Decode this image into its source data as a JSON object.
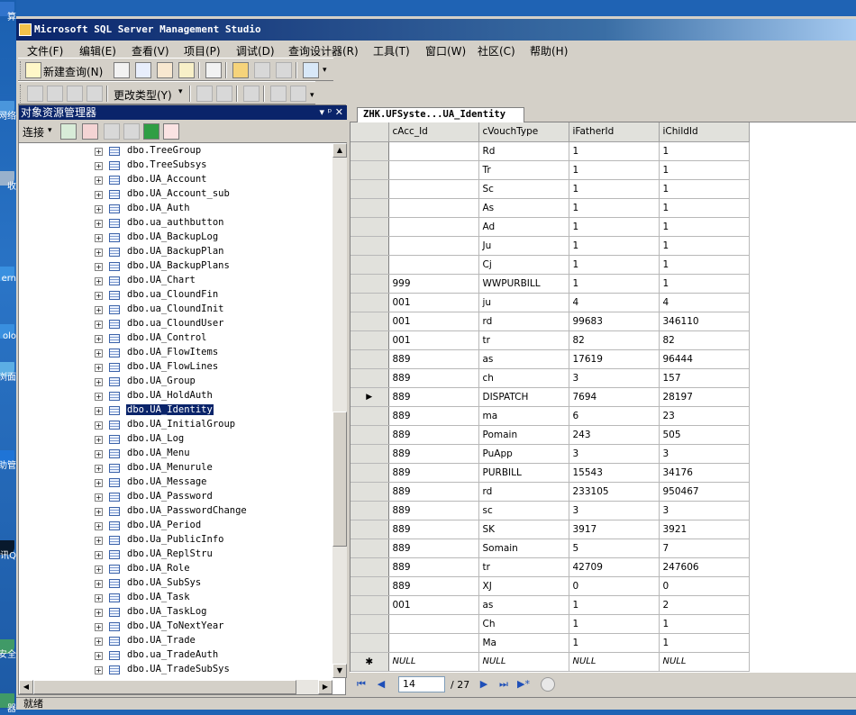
{
  "desktop": {
    "icons": [
      {
        "label": "算",
        "color": "#3a7bd5"
      },
      {
        "label": "网络",
        "color": "#58a6e8"
      },
      {
        "label": "收",
        "color": "#c0c8d0"
      },
      {
        "label": "ern",
        "color": "#3f9ae8"
      },
      {
        "label": "olo",
        "color": "#3f9ae8"
      },
      {
        "label": "浏面",
        "color": "#6fc3f0"
      },
      {
        "label": "助管",
        "color": "#1e78e0"
      },
      {
        "label": "讯Q",
        "color": "#000000"
      },
      {
        "label": "安全",
        "color": "#4caf50"
      },
      {
        "label": "器",
        "color": "#4caf50"
      }
    ]
  },
  "window": {
    "title": "Microsoft SQL Server Management Studio"
  },
  "menu": [
    "文件(F)",
    "编辑(E)",
    "查看(V)",
    "项目(P)",
    "调试(D)",
    "查询设计器(R)",
    "工具(T)",
    "窗口(W)",
    "社区(C)",
    "帮助(H)"
  ],
  "toolbar": {
    "new_query": "新建查询(N)",
    "change_type": "更改类型(Y)"
  },
  "object_explorer": {
    "title": "对象资源管理器",
    "pin_controls": "▾ ᵖ ✕",
    "connect_label": "连接",
    "items": [
      "dbo.TreeGroup",
      "dbo.TreeSubsys",
      "dbo.UA_Account",
      "dbo.UA_Account_sub",
      "dbo.UA_Auth",
      "dbo.ua_authbutton",
      "dbo.UA_BackupLog",
      "dbo.UA_BackupPlan",
      "dbo.UA_BackupPlans",
      "dbo.UA_Chart",
      "dbo.ua_CloundFin",
      "dbo.ua_CloundInit",
      "dbo.ua_CloundUser",
      "dbo.UA_Control",
      "dbo.UA_FlowItems",
      "dbo.UA_FlowLines",
      "dbo.UA_Group",
      "dbo.UA_HoldAuth",
      "dbo.UA_Identity",
      "dbo.UA_InitialGroup",
      "dbo.UA_Log",
      "dbo.UA_Menu",
      "dbo.UA_Menurule",
      "dbo.UA_Message",
      "dbo.UA_Password",
      "dbo.UA_PasswordChange",
      "dbo.UA_Period",
      "dbo.Ua_PublicInfo",
      "dbo.UA_ReplStru",
      "dbo.UA_Role",
      "dbo.UA_SubSys",
      "dbo.UA_Task",
      "dbo.UA_TaskLog",
      "dbo.UA_ToNextYear",
      "dbo.UA_Trade",
      "dbo.ua_TradeAuth",
      "dbo.UA_TradeSubSys"
    ],
    "selected": "dbo.UA_Identity"
  },
  "results": {
    "tab_title": "ZHK.UFSyste...UA_Identity",
    "columns": [
      "cAcc_Id",
      "cVouchType",
      "iFatherId",
      "iChildId"
    ],
    "rows": [
      [
        "",
        "Rd",
        "1",
        "1"
      ],
      [
        "",
        "Tr",
        "1",
        "1"
      ],
      [
        "",
        "Sc",
        "1",
        "1"
      ],
      [
        "",
        "As",
        "1",
        "1"
      ],
      [
        "",
        "Ad",
        "1",
        "1"
      ],
      [
        "",
        "Ju",
        "1",
        "1"
      ],
      [
        "",
        "Cj",
        "1",
        "1"
      ],
      [
        "999",
        "WWPURBILL",
        "1",
        "1"
      ],
      [
        "001",
        "ju",
        "4",
        "4"
      ],
      [
        "001",
        "rd",
        "99683",
        "346110"
      ],
      [
        "001",
        "tr",
        "82",
        "82"
      ],
      [
        "889",
        "as",
        "17619",
        "96444"
      ],
      [
        "889",
        "ch",
        "3",
        "157"
      ],
      [
        "889",
        "DISPATCH",
        "7694",
        "28197"
      ],
      [
        "889",
        "ma",
        "6",
        "23"
      ],
      [
        "889",
        "Pomain",
        "243",
        "505"
      ],
      [
        "889",
        "PuApp",
        "3",
        "3"
      ],
      [
        "889",
        "PURBILL",
        "15543",
        "34176"
      ],
      [
        "889",
        "rd",
        "233105",
        "950467"
      ],
      [
        "889",
        "sc",
        "3",
        "3"
      ],
      [
        "889",
        "SK",
        "3917",
        "3921"
      ],
      [
        "889",
        "Somain",
        "5",
        "7"
      ],
      [
        "889",
        "tr",
        "42709",
        "247606"
      ],
      [
        "889",
        "XJ",
        "0",
        "0"
      ],
      [
        "001",
        "as",
        "1",
        "2"
      ],
      [
        "",
        "Ch",
        "1",
        "1"
      ],
      [
        "",
        "Ma",
        "1",
        "1"
      ]
    ],
    "current_row_index": 13,
    "new_row": [
      "NULL",
      "NULL",
      "NULL",
      "NULL"
    ],
    "new_row_marker": "✱",
    "current_row_marker": "▶",
    "pager": {
      "current": "14",
      "total": "/ 27"
    }
  },
  "status": "就绪"
}
